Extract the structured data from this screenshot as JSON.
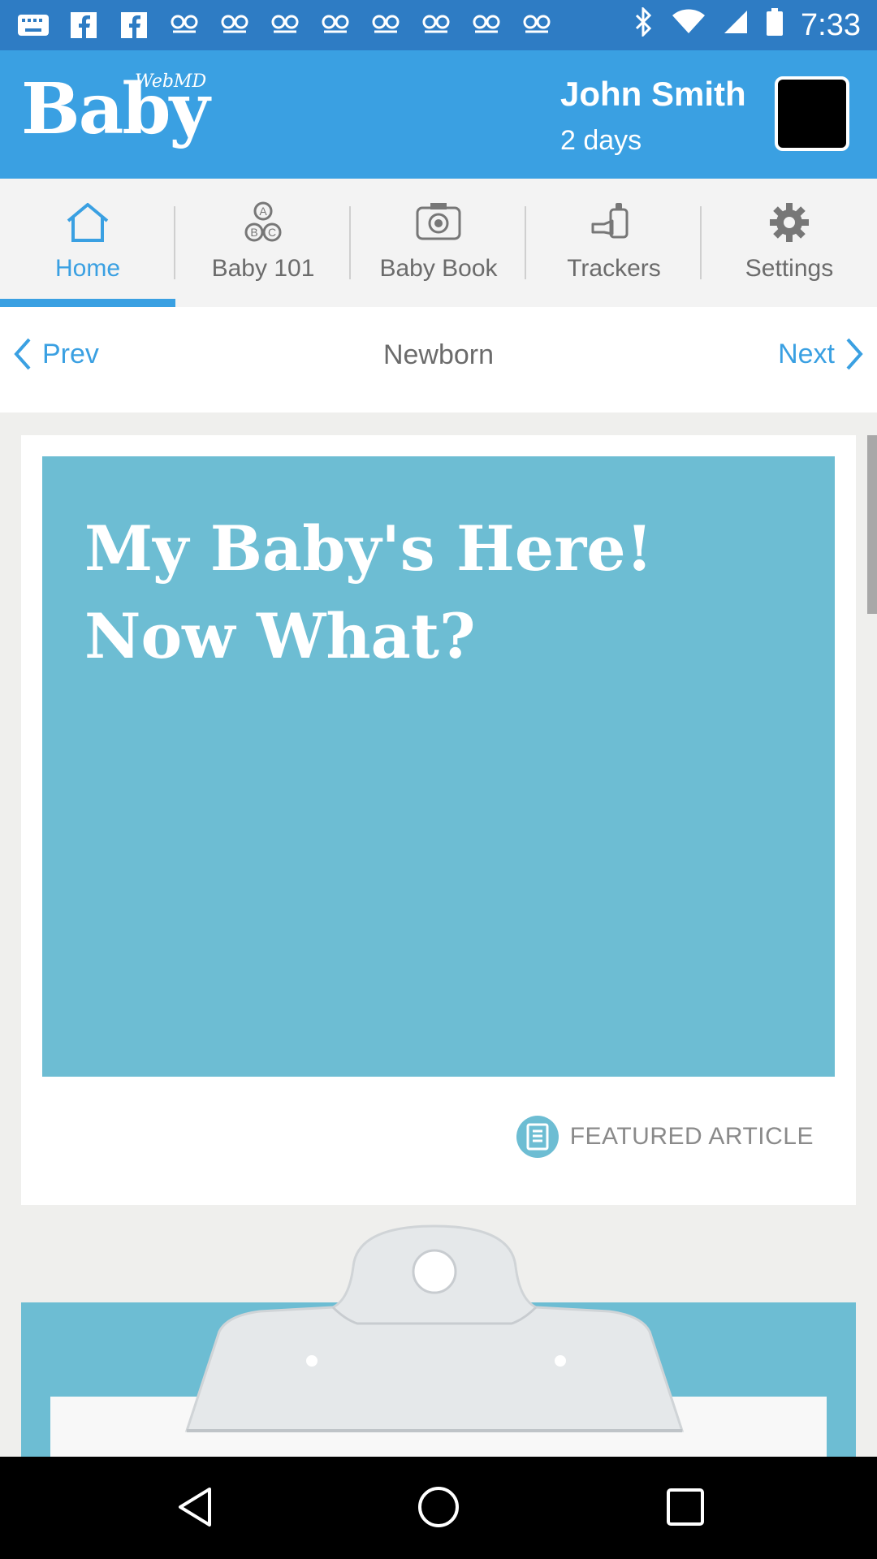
{
  "status_bar": {
    "time": "7:33",
    "notification_icons": [
      "keyboard-icon",
      "facebook-icon",
      "facebook-icon",
      "voicemail-icon",
      "voicemail-icon",
      "voicemail-icon",
      "voicemail-icon",
      "voicemail-icon",
      "voicemail-icon",
      "voicemail-icon",
      "voicemail-icon"
    ]
  },
  "header": {
    "logo_brand": "Baby",
    "logo_sub": "WebMD",
    "user_name": "John Smith",
    "user_age": "2 days"
  },
  "tabs": [
    {
      "label": "Home",
      "icon": "house-icon",
      "active": true
    },
    {
      "label": "Baby 101",
      "icon": "abc-blocks-icon",
      "active": false
    },
    {
      "label": "Baby Book",
      "icon": "camera-icon",
      "active": false
    },
    {
      "label": "Trackers",
      "icon": "bottle-icon",
      "active": false
    },
    {
      "label": "Settings",
      "icon": "gear-icon",
      "active": false
    }
  ],
  "nav": {
    "prev_label": "Prev",
    "title": "Newborn",
    "next_label": "Next"
  },
  "feature": {
    "title": "My Baby's Here! Now What?",
    "type_label": "FEATURED ARTICLE"
  },
  "colors": {
    "status_bar": "#2e7cc4",
    "header": "#3aa0e2",
    "accent": "#3aa0e2",
    "hero": "#6dbdd3"
  }
}
